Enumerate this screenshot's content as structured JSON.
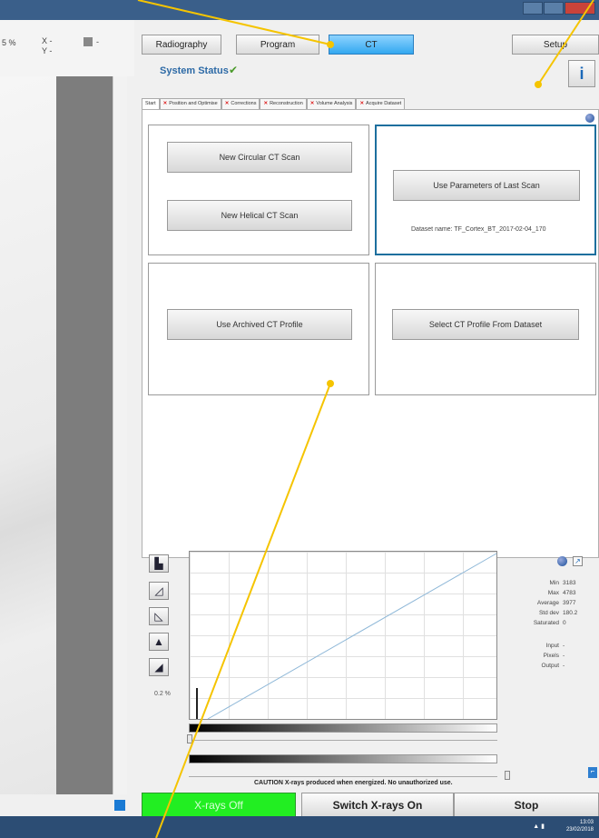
{
  "viewer": {
    "zoom": "5 %",
    "x_label": "X -",
    "y_label": "Y -",
    "swatch_dash": "-"
  },
  "toolbar": {
    "radiography": "Radiography",
    "program": "Program",
    "ct": "CT",
    "setup": "Setup"
  },
  "status": {
    "label": "System Status",
    "check": "✔"
  },
  "info_label": "i",
  "tabs": [
    {
      "label": "Start",
      "error": false
    },
    {
      "label": "Position and Optimise",
      "error": true
    },
    {
      "label": "Corrections",
      "error": true
    },
    {
      "label": "Reconstruction",
      "error": true
    },
    {
      "label": "Volume Analysis",
      "error": true
    },
    {
      "label": "Acquire Dataset",
      "error": true
    }
  ],
  "start": {
    "new_circular": "New Circular CT Scan",
    "new_helical": "New Helical CT Scan",
    "use_last": "Use Parameters of Last Scan",
    "dataset_name": "Dataset name: TF_Cortex_BT_2017-02-04_170",
    "use_archived": "Use Archived CT Profile",
    "select_profile": "Select CT Profile From Dataset"
  },
  "histogram": {
    "percent": "0.2 %",
    "stats": [
      {
        "label": "Min",
        "value": "3183"
      },
      {
        "label": "Max",
        "value": "4783"
      },
      {
        "label": "Average",
        "value": "3977"
      },
      {
        "label": "Std dev",
        "value": "180.2"
      },
      {
        "label": "Saturated",
        "value": "0"
      }
    ],
    "io": [
      {
        "label": "Input",
        "value": "-"
      },
      {
        "label": "Pixels",
        "value": "-"
      },
      {
        "label": "Output",
        "value": "-"
      }
    ]
  },
  "caution": "CAUTION X-rays produced when energized. No unauthorized use.",
  "buttons": {
    "xrays_off": "X-rays Off",
    "switch_on": "Switch X-rays On",
    "stop": "Stop"
  },
  "taskbar": {
    "time": "13:03",
    "date": "23/02/2018"
  },
  "colors": {
    "accent": "#33a8f0",
    "xray_off": "#22ee22",
    "annotation": "#f5c400"
  }
}
